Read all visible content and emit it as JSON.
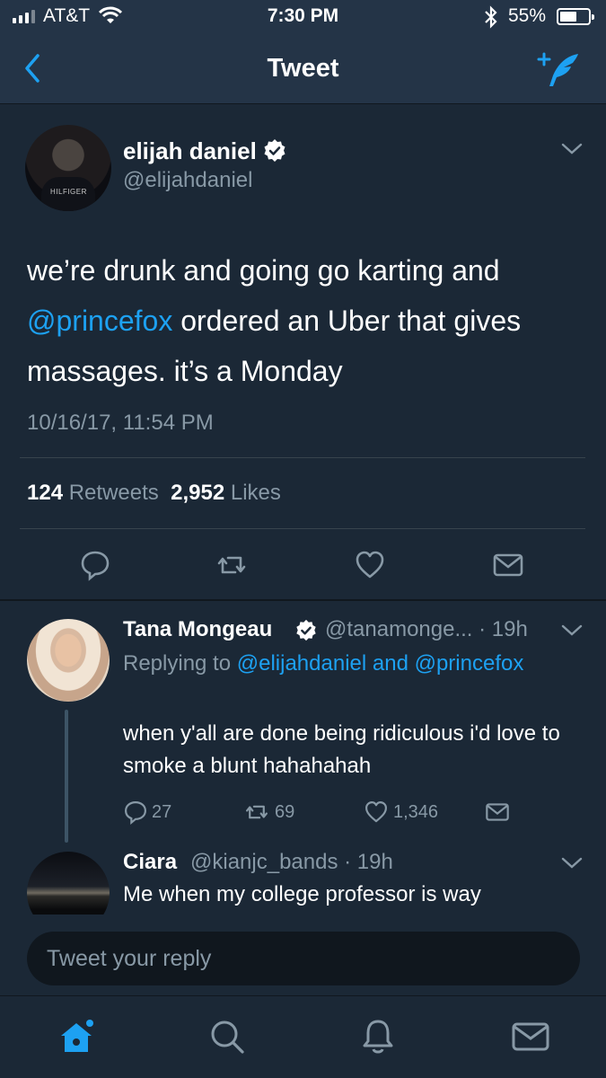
{
  "status_bar": {
    "carrier": "AT&T",
    "time": "7:30 PM",
    "battery": "55%"
  },
  "nav": {
    "title": "Tweet",
    "back_icon": "chevron-left-icon",
    "compose_icon": "compose-feather-icon"
  },
  "tweet": {
    "author_name": "elijah daniel",
    "author_handle": "@elijahdaniel",
    "text_part1": "we’re drunk and going go karting and ",
    "mention": "@princefox",
    "text_part2": " ordered an Uber that gives massages. it’s a Monday",
    "timestamp": "10/16/17, 11:54 PM",
    "retweets_count": "124",
    "retweets_label": "Retweets",
    "likes_count": "2,952",
    "likes_label": "Likes"
  },
  "replies": [
    {
      "name": "Tana Mongeau",
      "handle": "@tanamonge...",
      "time": "19h",
      "replying_prefix": "Replying to",
      "replying_to": "@elijahdaniel and @princefox",
      "text": "when y'all are done being ridiculous i'd love to smoke a blunt hahahahah",
      "reply_count": "27",
      "retweet_count": "69",
      "like_count": "1,346"
    },
    {
      "name": "Ciara",
      "handle": "@kianjc_bands",
      "time": "19h",
      "text": "Me when my college professor is way"
    }
  ],
  "composer": {
    "placeholder": "Tweet your reply"
  },
  "tabs": [
    "home-icon",
    "search-icon",
    "notifications-bell-icon",
    "messages-mail-icon"
  ],
  "colors": {
    "background": "#1b2836",
    "bar": "#243447",
    "accent": "#1da1f2",
    "muted": "#8899a6"
  }
}
